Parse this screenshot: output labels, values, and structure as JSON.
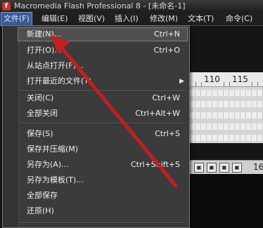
{
  "window": {
    "title": "Macromedia Flash Professional 8 - [未命名-1]"
  },
  "menubar": {
    "items": [
      {
        "label": "文件(F)"
      },
      {
        "label": "编辑(E)"
      },
      {
        "label": "视图(V)"
      },
      {
        "label": "插入(I)"
      },
      {
        "label": "修改(M)"
      },
      {
        "label": "文本(T)"
      },
      {
        "label": "命令(C)"
      }
    ]
  },
  "file_menu": {
    "items": [
      {
        "label": "新建(N)...",
        "shortcut": "Ctrl+N"
      },
      {
        "label": "打开(O)...",
        "shortcut": "Ctrl+O"
      },
      {
        "label": "从站点打开(F)...",
        "shortcut": ""
      },
      {
        "label": "打开最近的文件(T)",
        "shortcut": ""
      },
      {
        "label": "关闭(C)",
        "shortcut": "Ctrl+W"
      },
      {
        "label": "全部关闭",
        "shortcut": "Ctrl+Alt+W"
      },
      {
        "label": "保存(S)",
        "shortcut": "Ctrl+S"
      },
      {
        "label": "保存并压缩(M)",
        "shortcut": ""
      },
      {
        "label": "另存为(A)...",
        "shortcut": "Ctrl+Shift+S"
      },
      {
        "label": "另存为模板(T)...",
        "shortcut": ""
      },
      {
        "label": "全部保存",
        "shortcut": ""
      },
      {
        "label": "还原(H)",
        "shortcut": ""
      }
    ]
  },
  "timeline": {
    "ruler_labels": [
      "110",
      "115"
    ],
    "frame_number": "16"
  },
  "colors": {
    "annotation_arrow": "#c41e1e",
    "menu_bg": "#3b3b3b",
    "active_menu": "#3a5a9a"
  }
}
